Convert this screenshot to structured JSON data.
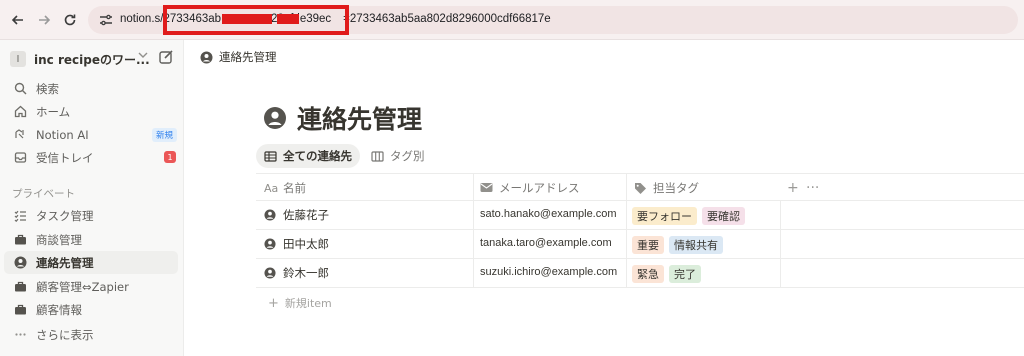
{
  "browser": {
    "url_visible": "notion.s",
    "url_middle": "2733463ab",
    "url_middle2": "28afde39ec",
    "url_tail": "=2733463ab5aa802d8296000cdf66817e"
  },
  "sidebar": {
    "workspace_initial": "I",
    "workspace_name": "inc recipeのワー...",
    "items": [
      {
        "label": "検索",
        "icon": "search-icon"
      },
      {
        "label": "ホーム",
        "icon": "home-icon"
      },
      {
        "label": "Notion AI",
        "icon": "notion-ai-icon",
        "badge": "新規"
      },
      {
        "label": "受信トレイ",
        "icon": "inbox-icon",
        "badge": "1"
      }
    ],
    "section_label": "プライベート",
    "pages": [
      {
        "label": "タスク管理",
        "icon": "checklist-icon"
      },
      {
        "label": "商談管理",
        "icon": "briefcase-icon"
      },
      {
        "label": "連絡先管理",
        "icon": "person-icon",
        "active": true
      },
      {
        "label": "顧客管理⇔Zapier",
        "icon": "briefcase-icon"
      },
      {
        "label": "顧客情報",
        "icon": "briefcase-icon"
      },
      {
        "label": "さらに表示",
        "icon": "more-icon"
      }
    ]
  },
  "breadcrumb": "連絡先管理",
  "page_title": "連絡先管理",
  "views": [
    {
      "label": "全ての連絡先",
      "active": true
    },
    {
      "label": "タグ別",
      "active": false
    }
  ],
  "columns": [
    {
      "label": "名前",
      "icon": "Aa"
    },
    {
      "label": "メールアドレス",
      "icon": "mail-icon"
    },
    {
      "label": "担当タグ",
      "icon": "tag-icon"
    }
  ],
  "rows": [
    {
      "name": "佐藤花子",
      "email": "sato.hanako@example.com",
      "tags": [
        {
          "label": "要フォロー",
          "color": "#fbeccc"
        },
        {
          "label": "要確認",
          "color": "#f5e0e9"
        }
      ]
    },
    {
      "name": "田中太郎",
      "email": "tanaka.taro@example.com",
      "tags": [
        {
          "label": "重要",
          "color": "#fbe4d6"
        },
        {
          "label": "情報共有",
          "color": "#dbe8f4"
        }
      ]
    },
    {
      "name": "鈴木一郎",
      "email": "suzuki.ichiro@example.com",
      "tags": [
        {
          "label": "緊急",
          "color": "#fbe4d6"
        },
        {
          "label": "完了",
          "color": "#dbeddb"
        }
      ]
    }
  ],
  "new_item_label": "新規item",
  "colors": {
    "accent_red": "#e01b1b",
    "sidebar_bg": "#f8f8f7"
  }
}
